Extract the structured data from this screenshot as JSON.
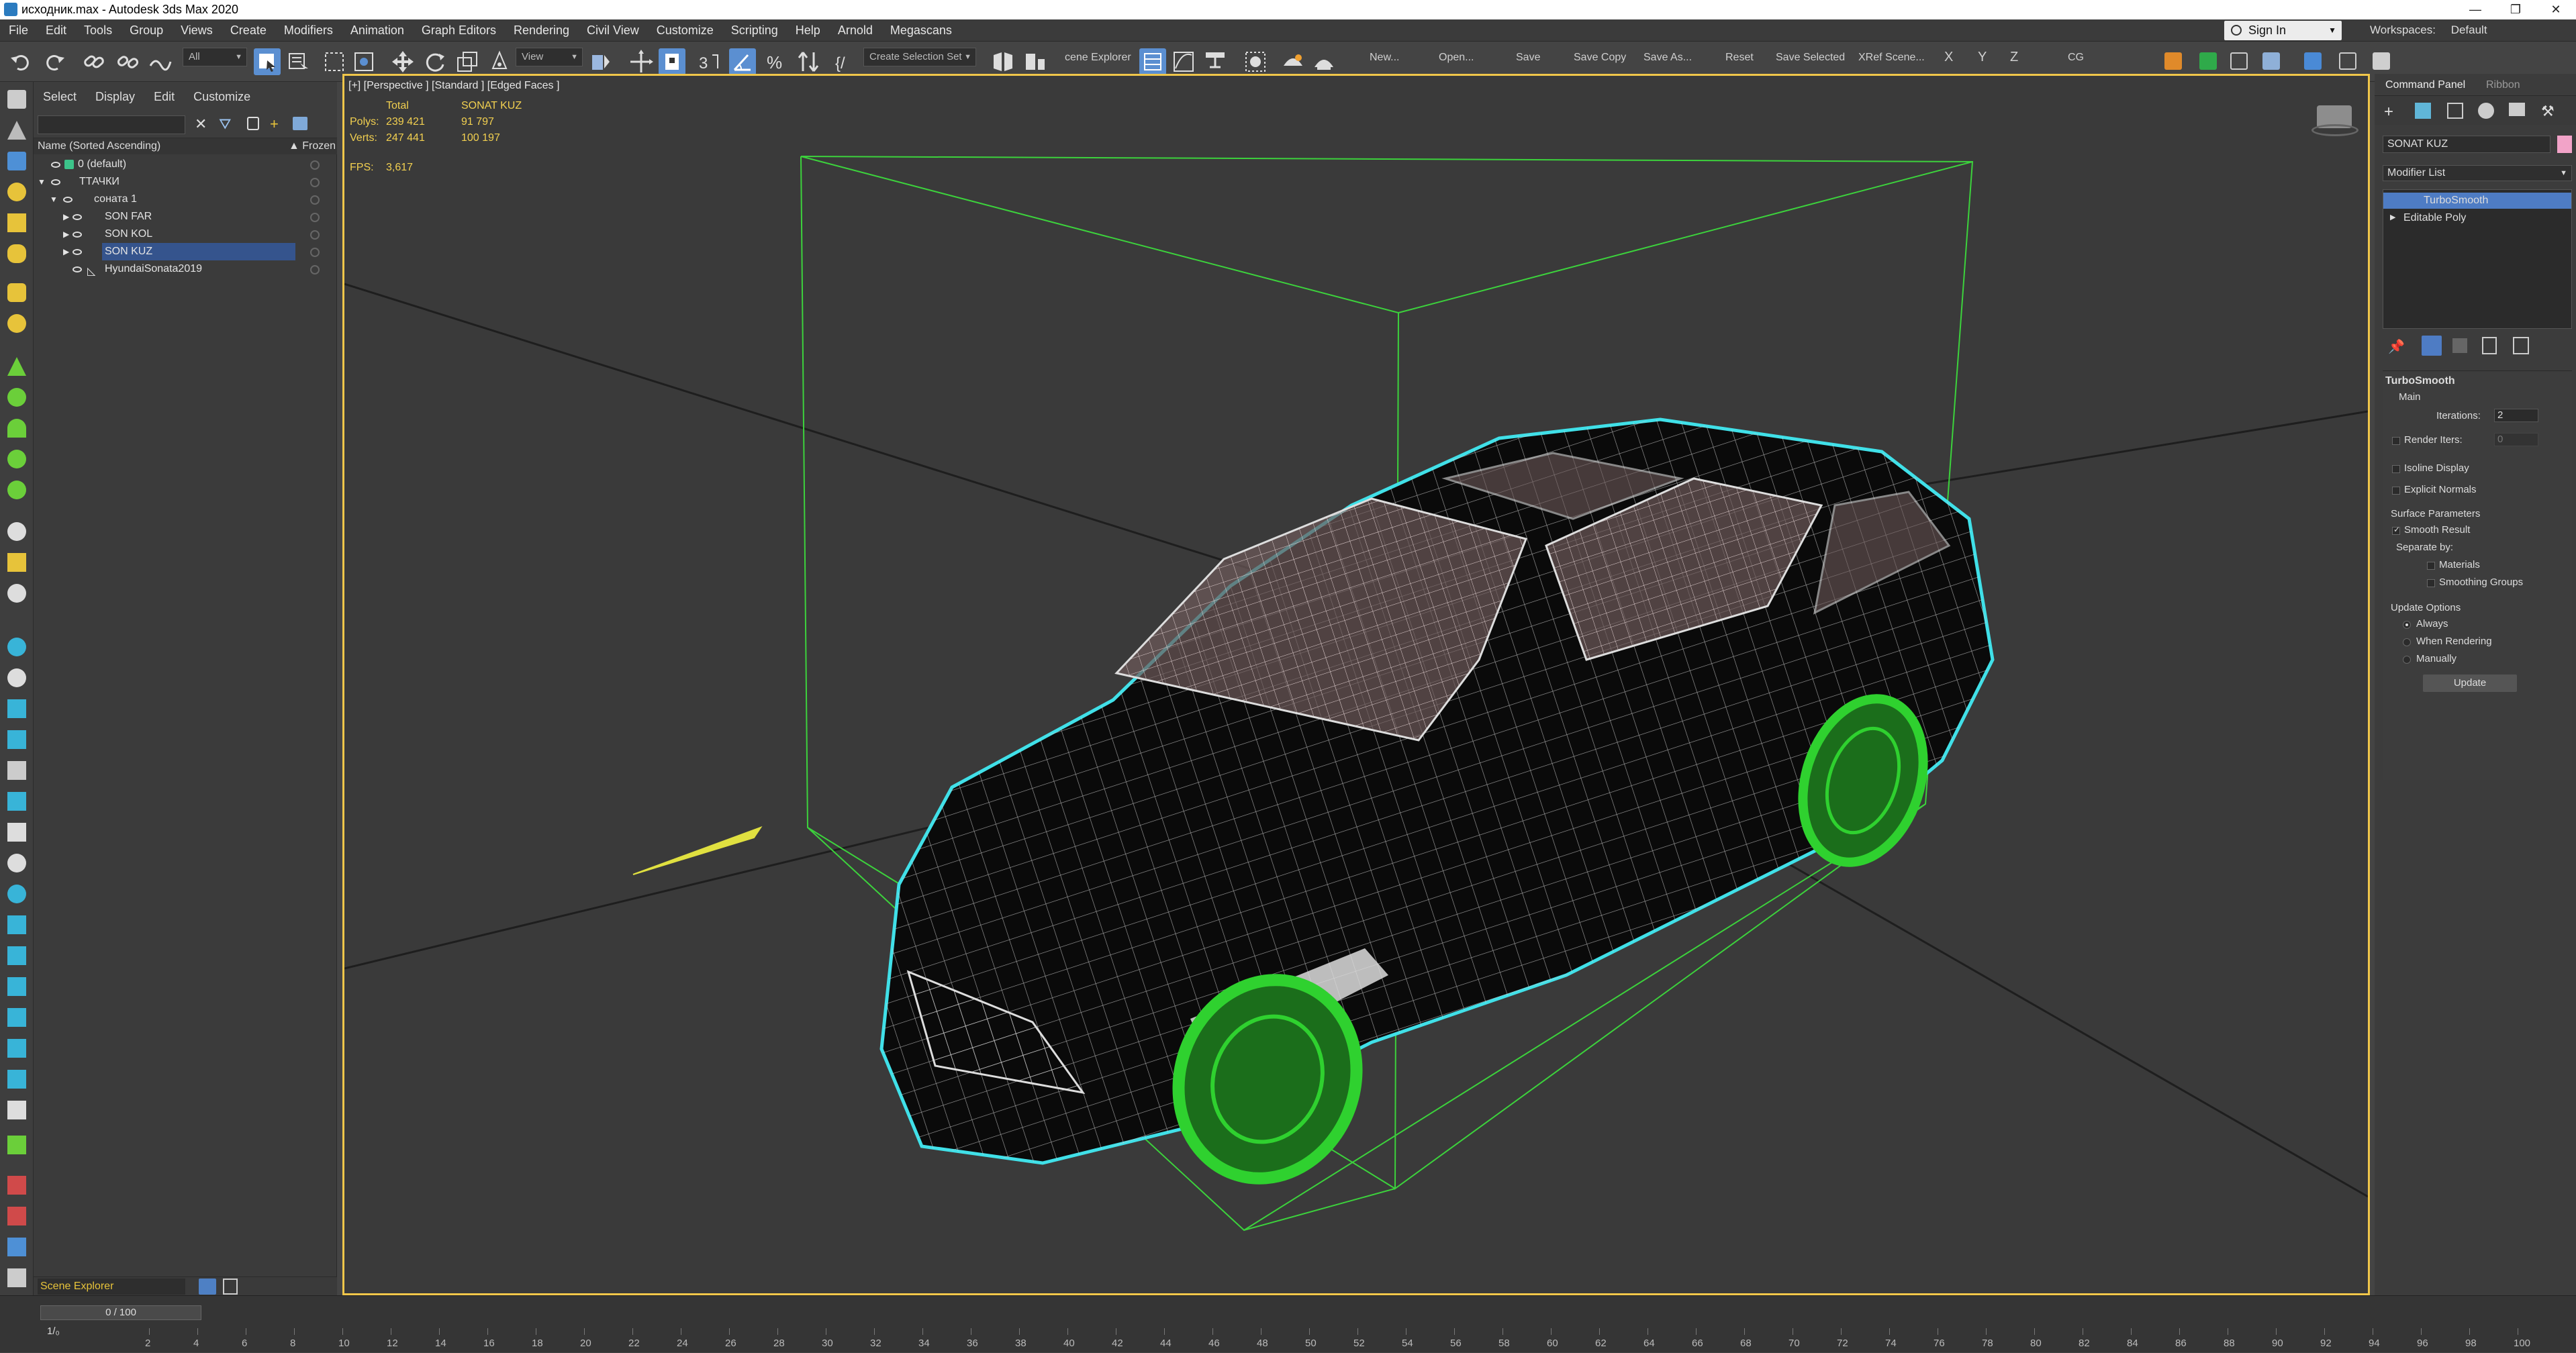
{
  "window": {
    "title": "исходник.max - Autodesk 3ds Max 2020",
    "sign_in": "Sign In",
    "workspaces_label": "Workspaces:",
    "workspace": "Default"
  },
  "menu": [
    "File",
    "Edit",
    "Tools",
    "Group",
    "Views",
    "Create",
    "Modifiers",
    "Animation",
    "Graph Editors",
    "Rendering",
    "Civil View",
    "Customize",
    "Scripting",
    "Help",
    "Arnold",
    "Megascans"
  ],
  "toolbar": {
    "filter": "All",
    "ref_coord": "View",
    "selection_set": "Create Selection Set",
    "scene_explorer_btn": "cene Explorer",
    "buttons": [
      "New...",
      "Open...",
      "Save",
      "Save Copy",
      "Save As...",
      "Reset",
      "Save Selected",
      "XRef Scene..."
    ],
    "axes": [
      "X",
      "Y",
      "Z"
    ],
    "cg": "CG"
  },
  "scene_explorer": {
    "tabs": [
      "Select",
      "Display",
      "Edit",
      "Customize"
    ],
    "column": "Name (Sorted Ascending)",
    "frozen": "▲ Frozen",
    "rows": [
      {
        "name": "0 (default)",
        "indent": 0
      },
      {
        "name": "ТТАЧКИ",
        "indent": 0
      },
      {
        "name": "соната 1",
        "indent": 1
      },
      {
        "name": "SON FAR",
        "indent": 2
      },
      {
        "name": "SON KOL",
        "indent": 2
      },
      {
        "name": "SON KUZ",
        "indent": 2,
        "selected": true
      },
      {
        "name": "HyundaiSonata2019",
        "indent": 2
      }
    ],
    "footer": "Scene Explorer"
  },
  "viewport": {
    "label": "[+] [Perspective ] [Standard ] [Edged Faces ]",
    "stats": {
      "total_hdr": "Total",
      "obj_hdr": "SONAT KUZ",
      "polys_label": "Polys:",
      "polys_total": "239 421",
      "polys_obj": "91 797",
      "verts_label": "Verts:",
      "verts_total": "247 441",
      "verts_obj": "100 197",
      "fps_label": "FPS:",
      "fps": "3,617"
    }
  },
  "command_panel": {
    "tabs": [
      "Command Panel",
      "Ribbon"
    ],
    "object_name": "SONAT KUZ",
    "modifier_list": "Modifier List",
    "stack": [
      "TurboSmooth",
      "Editable Poly"
    ],
    "rollout": "TurboSmooth",
    "main": "Main",
    "iterations_label": "Iterations:",
    "iterations": "2",
    "render_iters_label": "Render Iters:",
    "render_iters": "0",
    "isoline": "Isoline Display",
    "explicit": "Explicit Normals",
    "surface": "Surface Parameters",
    "smooth_result": "Smooth Result",
    "separate_by": "Separate by:",
    "materials": "Materials",
    "smoothing_groups": "Smoothing Groups",
    "update_options": "Update Options",
    "always": "Always",
    "when_rendering": "When Rendering",
    "manually": "Manually",
    "update_btn": "Update"
  },
  "timeline": {
    "frame": "0 / 100",
    "ticks": [
      "2",
      "4",
      "6",
      "8",
      "10",
      "12",
      "14",
      "16",
      "18",
      "20",
      "22",
      "24",
      "26",
      "28",
      "30",
      "32",
      "34",
      "36",
      "38",
      "40",
      "42",
      "44",
      "46",
      "48",
      "50",
      "52",
      "54",
      "56",
      "58",
      "60",
      "62",
      "64",
      "66",
      "68",
      "70",
      "72",
      "74",
      "76",
      "78",
      "80",
      "82",
      "84",
      "86",
      "88",
      "90",
      "92",
      "94",
      "96",
      "98",
      "100"
    ]
  },
  "colors": {
    "accent": "#5b8fd1",
    "viewport_border": "#f0c64a",
    "stats": "#f2d050",
    "selection_box": "#3cd23c",
    "car_outline": "#40e0e8",
    "wheels": "#2fd12f"
  }
}
